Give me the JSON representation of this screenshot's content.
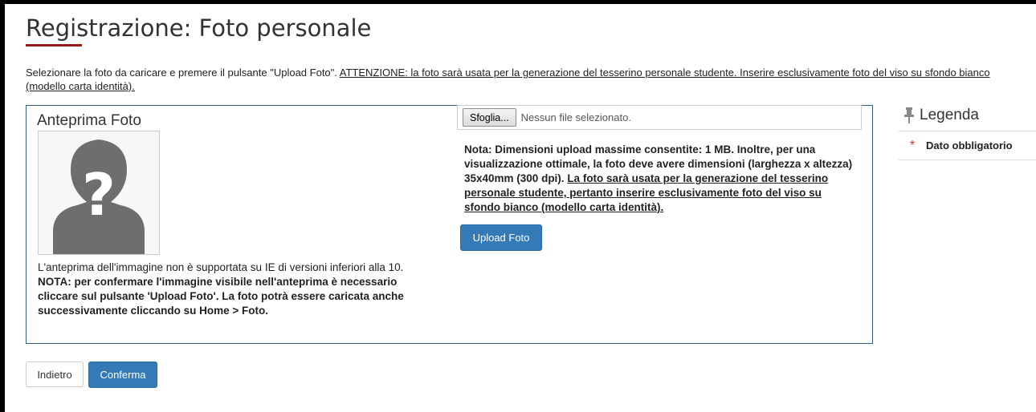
{
  "page": {
    "title": "Registrazione: Foto personale",
    "intro_text": "Selezionare la foto da caricare e premere il pulsante \"Upload Foto\". ",
    "intro_warning": "ATTENZIONE: la foto sarà usata per la generazione del tesserino personale studente. Inserire esclusivamente foto del viso su sfondo bianco (modello carta identità)."
  },
  "preview": {
    "title": "Anteprima Foto",
    "ie_note": "L'anteprima dell'immagine non è supportata su IE di versioni inferiori alla 10.",
    "confirm_note": "NOTA: per confermare l'immagine visibile nell'anteprima è necessario cliccare sul pulsante 'Upload Foto'. La foto potrà essere caricata anche successivamente cliccando su Home > Foto."
  },
  "upload": {
    "browse_label": "Sfoglia...",
    "file_status": "Nessun file selezionato.",
    "size_note": " Nota: Dimensioni upload massime consentite: 1 MB. Inoltre, per una visualizzazione ottimale, la foto deve avere dimensioni (larghezza x altezza) 35x40mm (300 dpi). ",
    "usage_note": "La foto sarà usata per la generazione del tesserino personale studente, pertanto inserire esclusivamente foto del viso su sfondo bianco (modello carta identità).",
    "button_label": "Upload Foto"
  },
  "legend": {
    "title": "Legenda",
    "required_symbol": "*",
    "required_label": "Dato obbligatorio"
  },
  "actions": {
    "back_label": "Indietro",
    "confirm_label": "Conferma"
  },
  "colors": {
    "accent": "#9b1b1b",
    "primary_button": "#337ab7",
    "panel_border": "#2f5f7a",
    "required": "#c9302c"
  },
  "icons": {
    "legend": "pushpin-icon",
    "required": "asterisk-icon",
    "placeholder": "unknown-person-icon"
  }
}
